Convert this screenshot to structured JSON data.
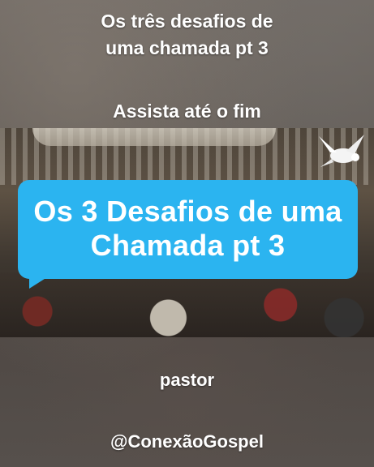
{
  "top_caption": {
    "line1": "Os três desafios de",
    "line2": "uma chamada pt 3"
  },
  "watch_caption": "Assista até o fim",
  "title_bubble": {
    "line1": "Os 3 Desafios de uma",
    "line2": "Chamada pt 3",
    "color": "#2bb4f0"
  },
  "pastor_caption": "pastor",
  "handle_caption": "@ConexãoGospel",
  "icons": {
    "dove": "dove-icon"
  }
}
